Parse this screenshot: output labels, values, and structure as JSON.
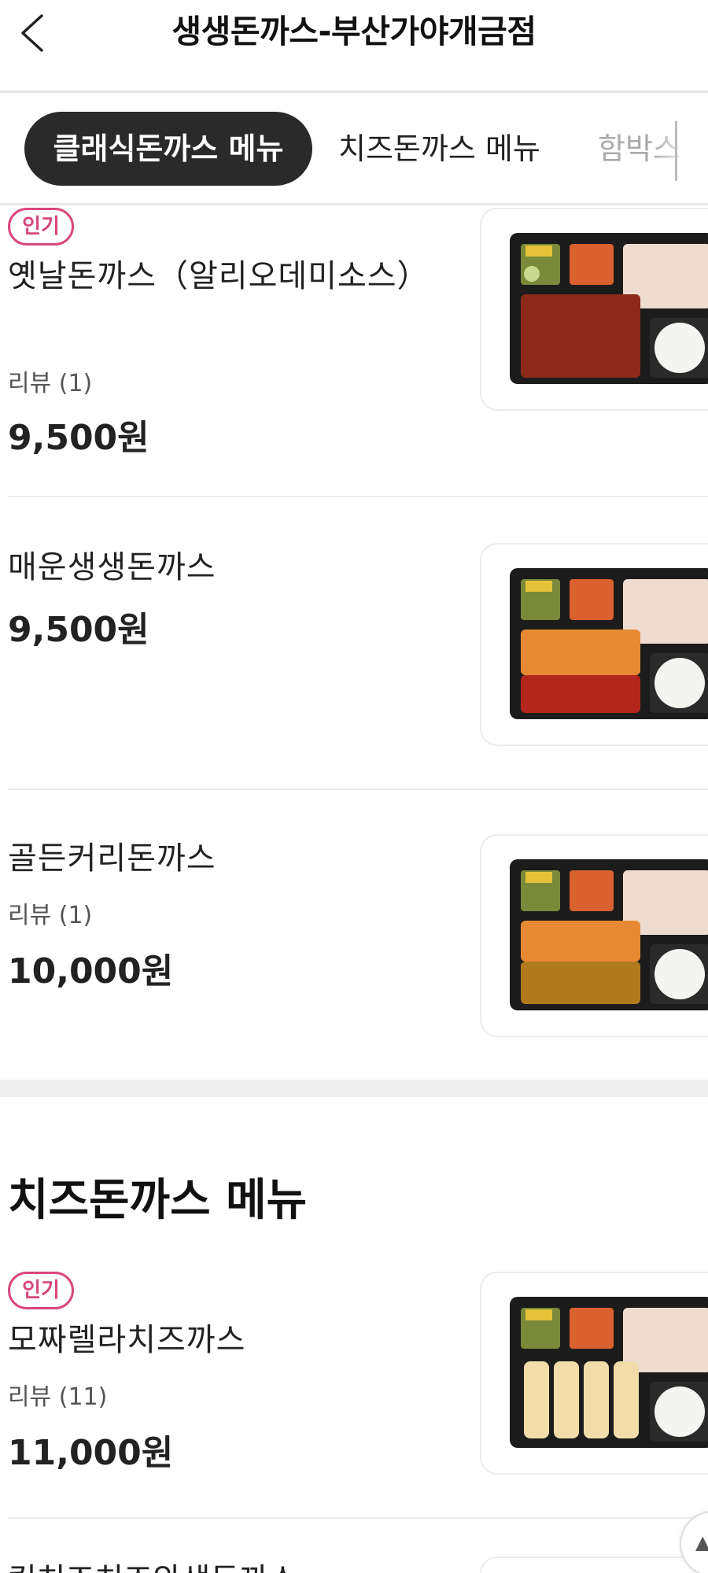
{
  "header": {
    "title": "생생돈까스-부산가야개금점",
    "back_icon": "chevron-left-icon"
  },
  "tabs": [
    {
      "label": "클래식돈까스 메뉴",
      "active": true
    },
    {
      "label": "치즈돈까스 메뉴",
      "active": false
    },
    {
      "label": "함박스",
      "active": false
    }
  ],
  "menu": {
    "items": [
      {
        "badge": "인기",
        "name": "옛날돈까스（알리오데미소스）",
        "review": "리뷰 (1)",
        "price": "9,500원"
      },
      {
        "badge": "",
        "name": "매운생생돈까스",
        "review": "",
        "price": "9,500원"
      },
      {
        "badge": "",
        "name": "골든커리돈까스",
        "review": "리뷰 (1)",
        "price": "10,000원"
      }
    ]
  },
  "cheese_section": {
    "title": "치즈돈까스 메뉴",
    "items": [
      {
        "badge": "인기",
        "name": "모짜렐라치즈까스",
        "review": "리뷰 (11)",
        "price": "11,000원"
      },
      {
        "name": "킹치즈치즈와생돈까스"
      }
    ]
  },
  "colors": {
    "accent": "#d9467d",
    "active_tab": "#2a2a2a"
  }
}
